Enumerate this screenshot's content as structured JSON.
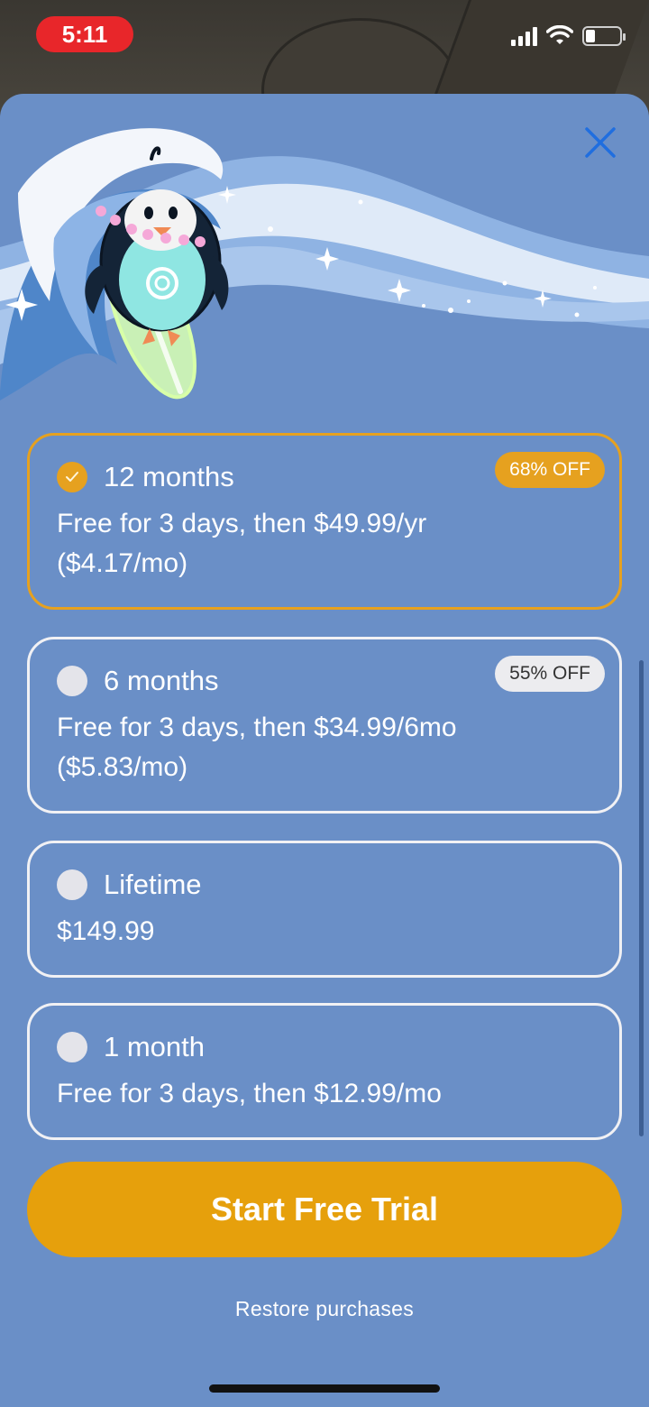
{
  "status_bar": {
    "time": "5:11"
  },
  "colors": {
    "sheet_bg": "#6a8fc7",
    "accent": "#e6a11f",
    "close_icon": "#1f6ee0"
  },
  "plans": [
    {
      "title": "12 months",
      "description_line1": "Free for 3 days, then $49.99/yr",
      "description_line2": "($4.17/mo)",
      "badge": "68% OFF",
      "selected": true
    },
    {
      "title": "6 months",
      "description_line1": "Free for 3 days, then $34.99/6mo",
      "description_line2": "($5.83/mo)",
      "badge": "55% OFF",
      "selected": false
    },
    {
      "title": "Lifetime",
      "description_line1": "$149.99",
      "selected": false
    },
    {
      "title": "1 month",
      "description_line1": "Free for 3 days, then $12.99/mo",
      "selected": false
    }
  ],
  "cta": {
    "label": "Start Free Trial"
  },
  "restore": {
    "label": "Restore purchases"
  },
  "icons": {
    "close": "close-icon",
    "check": "check-icon"
  }
}
